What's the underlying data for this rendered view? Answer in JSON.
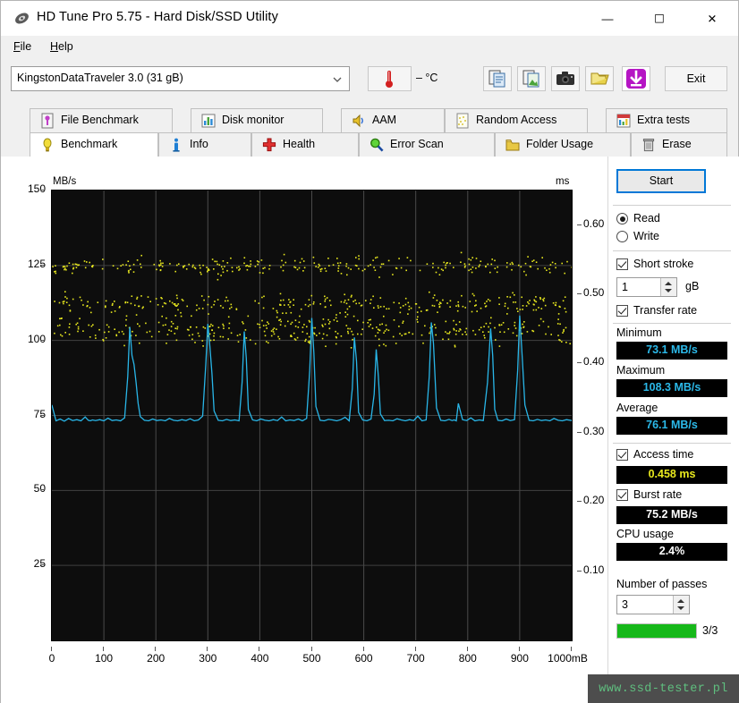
{
  "window": {
    "title": "HD Tune Pro 5.75 - Hard Disk/SSD Utility",
    "icon": "hdtune-logo-icon",
    "minimize": "—",
    "maximize": "☐",
    "close": "✕"
  },
  "menu": {
    "items": [
      {
        "label": "File",
        "mnemonic": "F",
        "rest": "ile"
      },
      {
        "label": "Help",
        "mnemonic": "H",
        "rest": "elp"
      }
    ]
  },
  "toolbar": {
    "drive_selected": "KingstonDataTraveler 3.0 (31 gB)",
    "temperature": "– °C",
    "exit_label": "Exit",
    "buttons": [
      {
        "name": "copy-icon"
      },
      {
        "name": "copy-image-icon"
      },
      {
        "name": "camera-icon"
      },
      {
        "name": "folder-open-icon"
      },
      {
        "name": "download-icon"
      }
    ]
  },
  "tabs": {
    "row1": [
      {
        "label": "File Benchmark",
        "icon": "file-benchmark-icon",
        "active": false
      },
      {
        "label": "Disk monitor",
        "icon": "disk-monitor-icon",
        "active": false
      },
      {
        "label": "AAM",
        "icon": "speaker-icon",
        "active": false
      },
      {
        "label": "Random Access",
        "icon": "random-access-icon",
        "active": false
      },
      {
        "label": "Extra tests",
        "icon": "extra-tests-icon",
        "active": false
      }
    ],
    "row2": [
      {
        "label": "Benchmark",
        "icon": "lightbulb-icon",
        "active": true
      },
      {
        "label": "Info",
        "icon": "info-icon",
        "active": false
      },
      {
        "label": "Health",
        "icon": "health-cross-icon",
        "active": false
      },
      {
        "label": "Error Scan",
        "icon": "magnifier-icon",
        "active": false
      },
      {
        "label": "Folder Usage",
        "icon": "folder-icon",
        "active": false
      },
      {
        "label": "Erase",
        "icon": "trash-icon",
        "active": false
      }
    ]
  },
  "panel": {
    "start_label": "Start",
    "mode": {
      "read_label": "Read",
      "write_label": "Write",
      "selected": "Read"
    },
    "short_stroke": {
      "label": "Short stroke",
      "checked": true,
      "value": "1",
      "unit": "gB"
    },
    "transfer_rate": {
      "label": "Transfer rate",
      "checked": true
    },
    "minimum": {
      "label": "Minimum",
      "value": "73.1 MB/s",
      "color": "#2bb8e8"
    },
    "maximum": {
      "label": "Maximum",
      "value": "108.3 MB/s",
      "color": "#2bb8e8"
    },
    "average": {
      "label": "Average",
      "value": "76.1 MB/s",
      "color": "#2bb8e8"
    },
    "access_time": {
      "label": "Access time",
      "checked": true,
      "value": "0.458 ms",
      "color": "#e8e81e"
    },
    "burst_rate": {
      "label": "Burst rate",
      "checked": true,
      "value": "75.2 MB/s",
      "color": "#ffffff"
    },
    "cpu_usage": {
      "label": "CPU usage",
      "value": "2.4%",
      "color": "#ffffff"
    },
    "passes": {
      "label": "Number of passes",
      "value": "3",
      "progress_text": "3/3",
      "progress_percent": 100,
      "progress_color": "#16b81a"
    }
  },
  "watermark": {
    "text": "www.ssd-tester.pl"
  },
  "chart_data": {
    "type": "line",
    "title": "",
    "xlabel": "mB",
    "ylabel": "MB/s",
    "y2label": "ms",
    "xlim": [
      0,
      1000
    ],
    "ylim": [
      0,
      150
    ],
    "y2lim": [
      0,
      0.65
    ],
    "grid": true,
    "legend": "none",
    "background": "#0d0d0d",
    "grid_color": "#4a4a4a",
    "xticks": [
      0,
      100,
      200,
      300,
      400,
      500,
      600,
      700,
      800,
      900,
      1000
    ],
    "xtick_labels": [
      "0",
      "100",
      "200",
      "300",
      "400",
      "500",
      "600",
      "700",
      "800",
      "900",
      "1000"
    ],
    "yticks": [
      25,
      50,
      75,
      100,
      125,
      150
    ],
    "ytick_labels": [
      "25",
      "50",
      "75",
      "100",
      "125",
      "150"
    ],
    "y2ticks": [
      0.1,
      0.2,
      0.3,
      0.4,
      0.5,
      0.6
    ],
    "y2tick_labels": [
      "0.10",
      "0.20",
      "0.30",
      "0.40",
      "0.50",
      "0.60"
    ],
    "series": [
      {
        "name": "Transfer rate",
        "type": "line",
        "color": "#29b6e8",
        "axis": "left",
        "baseline": 73.4,
        "x": [
          0,
          8,
          16,
          24,
          32,
          40,
          48,
          56,
          64,
          70,
          74,
          78,
          84,
          92,
          100,
          108,
          116,
          124,
          132,
          140,
          146,
          150,
          154,
          158,
          162,
          166,
          170,
          178,
          186,
          194,
          202,
          210,
          218,
          226,
          234,
          242,
          250,
          258,
          266,
          274,
          282,
          290,
          296,
          300,
          304,
          308,
          312,
          320,
          328,
          336,
          344,
          352,
          360,
          366,
          370,
          374,
          378,
          386,
          394,
          402,
          410,
          418,
          426,
          434,
          442,
          450,
          458,
          466,
          474,
          482,
          490,
          496,
          500,
          504,
          508,
          516,
          524,
          532,
          540,
          548,
          556,
          564,
          572,
          578,
          582,
          586,
          590,
          598,
          606,
          614,
          620,
          624,
          628,
          632,
          640,
          648,
          656,
          664,
          672,
          680,
          688,
          696,
          704,
          712,
          720,
          726,
          730,
          734,
          740,
          748,
          756,
          764,
          770,
          774,
          778,
          782,
          790,
          798,
          806,
          814,
          822,
          830,
          838,
          844,
          848,
          852,
          858,
          866,
          874,
          882,
          890,
          896,
          900,
          904,
          910,
          918,
          926,
          934,
          942,
          950,
          958,
          966,
          974,
          982,
          990,
          1000
        ],
        "y": [
          78.5,
          73.2,
          73.8,
          73.1,
          74.0,
          73.3,
          73.6,
          73.2,
          74.5,
          73.4,
          73.2,
          73.5,
          73.3,
          73.6,
          73.2,
          74.1,
          73.3,
          73.5,
          73.2,
          74.2,
          88.0,
          104.5,
          95.0,
          92.0,
          86.0,
          79.0,
          74.6,
          73.4,
          73.2,
          73.8,
          73.3,
          73.5,
          73.2,
          74.0,
          73.4,
          73.2,
          73.6,
          73.3,
          73.9,
          73.2,
          73.5,
          74.8,
          92.0,
          105.5,
          98.0,
          89.0,
          76.5,
          73.4,
          73.2,
          73.7,
          73.3,
          73.5,
          73.2,
          86.0,
          103.0,
          94.0,
          77.0,
          73.5,
          73.2,
          73.8,
          73.4,
          73.2,
          73.6,
          73.3,
          74.5,
          73.2,
          73.5,
          73.3,
          73.8,
          73.2,
          74.0,
          90.0,
          107.5,
          96.0,
          78.0,
          73.4,
          73.2,
          73.7,
          73.5,
          73.2,
          73.6,
          74.4,
          73.2,
          84.0,
          101.0,
          93.0,
          76.0,
          73.5,
          73.2,
          73.8,
          82.0,
          97.0,
          88.0,
          75.5,
          73.3,
          73.4,
          73.2,
          73.9,
          73.5,
          73.2,
          73.6,
          73.3,
          74.8,
          73.2,
          73.5,
          88.0,
          106.0,
          99.0,
          77.5,
          73.4,
          73.2,
          73.7,
          73.3,
          73.5,
          73.2,
          79.0,
          73.6,
          73.3,
          74.2,
          73.2,
          73.5,
          73.3,
          86.0,
          104.0,
          95.0,
          77.0,
          73.4,
          73.2,
          73.8,
          73.3,
          73.6,
          90.0,
          108.3,
          97.0,
          78.5,
          73.4,
          73.2,
          73.7,
          73.3,
          73.5,
          73.2,
          74.0,
          73.4,
          73.2,
          73.6,
          73.3,
          73.5
        ]
      },
      {
        "name": "Access time",
        "type": "scatter",
        "color": "#e8e81e",
        "axis": "right",
        "point_size": 1.6,
        "bands": [
          {
            "center_mbps": 125.0,
            "spread": 3.0,
            "density": 0.3
          },
          {
            "center_mbps": 112.5,
            "spread": 3.5,
            "density": 0.3
          },
          {
            "center_mbps": 104.0,
            "spread": 5.0,
            "density": 0.4
          }
        ],
        "count": 900,
        "note": "Access-time samples plotted against right-hand ms axis, appearing as three dense horizontal bands."
      }
    ]
  }
}
